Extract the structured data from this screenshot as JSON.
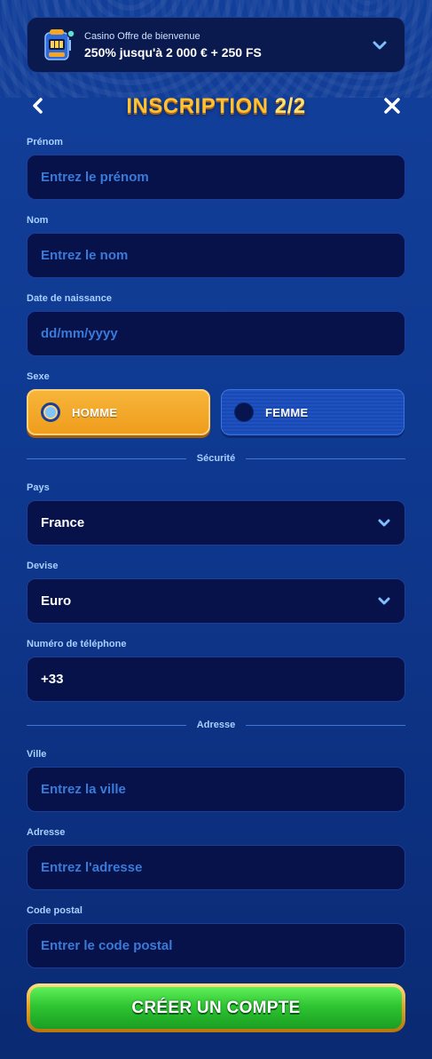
{
  "offer": {
    "line1": "Casino Offre de bienvenue",
    "line2": "250% jusqu'à 2 000 € + 250 FS"
  },
  "header": {
    "title": "INSCRIPTION",
    "step": "2/2"
  },
  "fields": {
    "prenom": {
      "label": "Prénom",
      "placeholder": "Entrez le prénom"
    },
    "nom": {
      "label": "Nom",
      "placeholder": "Entrez le nom"
    },
    "naissance": {
      "label": "Date de naissance",
      "placeholder": "dd/mm/yyyy"
    },
    "pays": {
      "label": "Pays",
      "value": "France"
    },
    "devise": {
      "label": "Devise",
      "value": "Euro"
    },
    "telephone": {
      "label": "Numéro de téléphone",
      "value": "+33"
    },
    "ville": {
      "label": "Ville",
      "placeholder": "Entrez la ville"
    },
    "adresse": {
      "label": "Adresse",
      "placeholder": "Entrez l'adresse"
    },
    "postal": {
      "label": "Code postal",
      "placeholder": "Entrer le code postal"
    }
  },
  "gender": {
    "label": "Sexe",
    "male": "HOMME",
    "female": "FEMME",
    "selected": "HOMME"
  },
  "sections": {
    "security": "Sécurité",
    "address": "Adresse"
  },
  "submit_label": "CRÉER UN COMPTE",
  "colors": {
    "background": "#123f9a",
    "field_bg": "#07124a",
    "placeholder": "#3a7ad8",
    "label": "#a8d0ff",
    "title": "#ffc233",
    "selected_gender": "#ef9d1c",
    "submit": "#2fc532"
  },
  "icons": {
    "offer": "slot-machine-icon",
    "expand": "chevron-down-icon",
    "back": "chevron-left-icon",
    "close": "close-icon"
  }
}
